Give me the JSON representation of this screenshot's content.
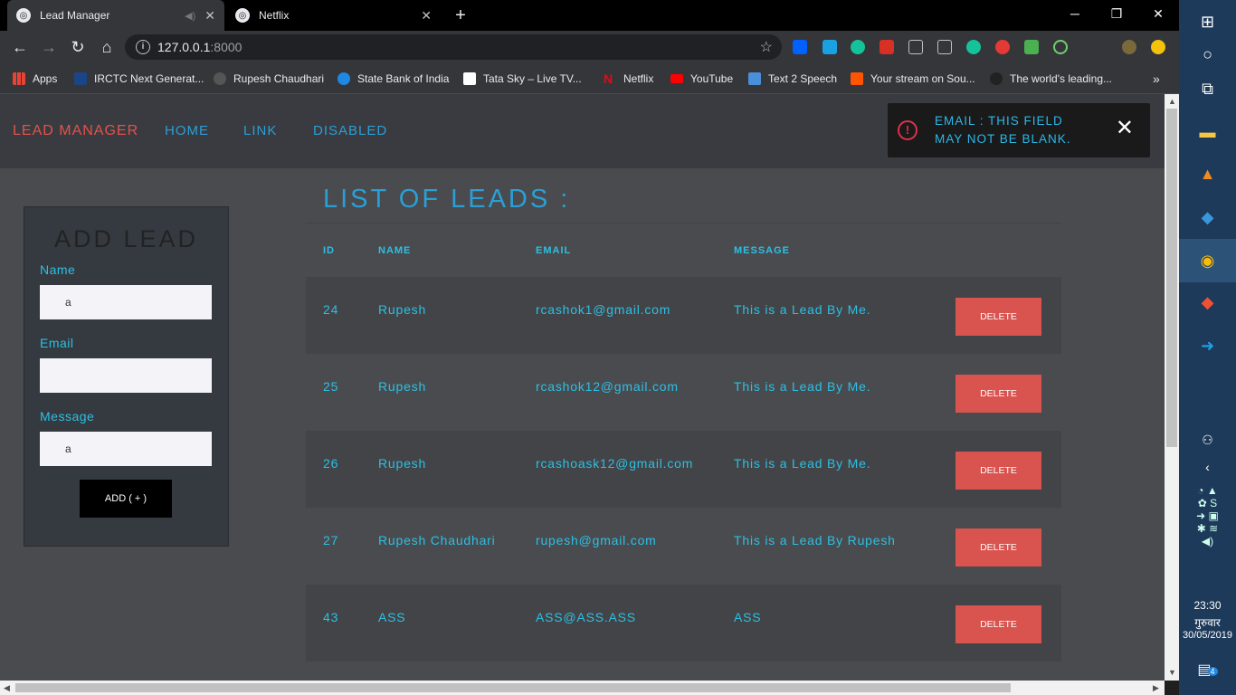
{
  "browser": {
    "tabs": [
      {
        "title": "Lead Manager",
        "active": true
      },
      {
        "title": "Netflix",
        "active": false
      }
    ],
    "url_host": "127.0.0.1",
    "url_port": ":8000",
    "bookmarks": [
      {
        "label": "Apps",
        "color": "#e8eaed"
      },
      {
        "label": "IRCTC Next Generat...",
        "color": "#1c4587"
      },
      {
        "label": "Rupesh Chaudhari",
        "color": "#555"
      },
      {
        "label": "State Bank of India",
        "color": "#1e88e5"
      },
      {
        "label": "Tata Sky – Live TV...",
        "color": "#fff"
      },
      {
        "label": "Netflix",
        "color": "#e50914"
      },
      {
        "label": "YouTube",
        "color": "#ff0000"
      },
      {
        "label": "Text 2 Speech",
        "color": "#4a90d9"
      },
      {
        "label": "Your stream on Sou...",
        "color": "#ff5500"
      },
      {
        "label": "The world's leading...",
        "color": "#222"
      }
    ]
  },
  "navbar": {
    "brand": "LEAD MANAGER",
    "links": [
      "HOME",
      "LINK",
      "DISABLED"
    ]
  },
  "toast": {
    "message": "EMAIL : THIS FIELD MAY NOT BE BLANK.",
    "close": "✕"
  },
  "form": {
    "title": "ADD LEAD",
    "name_label": "Name",
    "name_value": "a",
    "email_label": "Email",
    "email_value": "",
    "message_label": "Message",
    "message_value": "a",
    "submit_label": "ADD ( + )"
  },
  "list": {
    "title": "LIST OF LEADS :",
    "columns": [
      "ID",
      "NAME",
      "EMAIL",
      "MESSAGE"
    ],
    "delete_label": "DELETE",
    "rows": [
      {
        "id": "24",
        "name": "Rupesh",
        "email": "rcashok1@gmail.com",
        "message": "This is a Lead By Me."
      },
      {
        "id": "25",
        "name": "Rupesh",
        "email": "rcashok12@gmail.com",
        "message": "This is a Lead By Me."
      },
      {
        "id": "26",
        "name": "Rupesh",
        "email": "rcashoask12@gmail.com",
        "message": "This is a Lead By Me."
      },
      {
        "id": "27",
        "name": "Rupesh Chaudhari",
        "email": "rupesh@gmail.com",
        "message": "This is a Lead By Rupesh"
      },
      {
        "id": "43",
        "name": "ASS",
        "email": "ASS@ASS.ASS",
        "message": "ASS"
      }
    ]
  },
  "taskbar": {
    "time": "23:30",
    "day": "गुरुवार",
    "date": "30/05/2019",
    "notifications": "4"
  }
}
